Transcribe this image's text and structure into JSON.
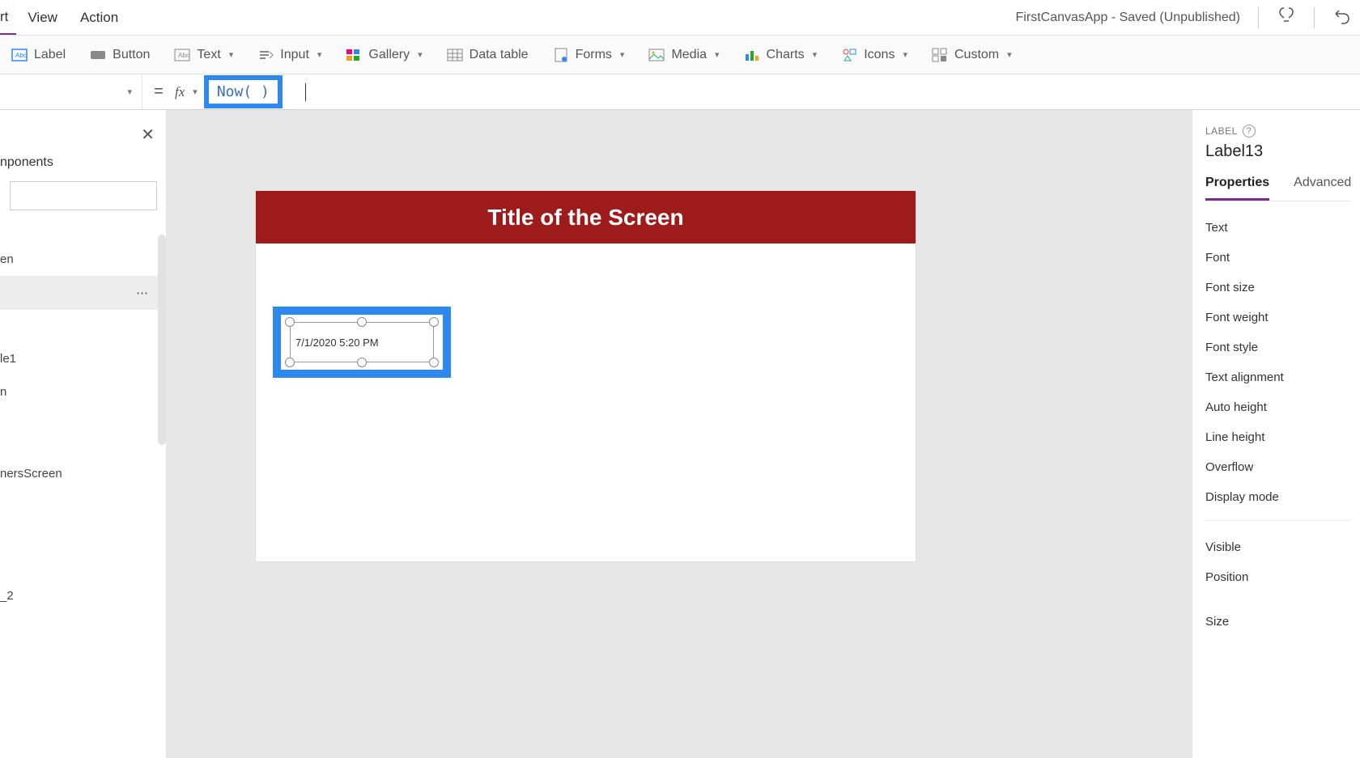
{
  "menubar": {
    "active_tab_fragment": "rt",
    "items": [
      "View",
      "Action"
    ],
    "app_status": "FirstCanvasApp - Saved (Unpublished)"
  },
  "ribbon": {
    "label": "Label",
    "button": "Button",
    "text": "Text",
    "input": "Input",
    "gallery": "Gallery",
    "datatable": "Data table",
    "forms": "Forms",
    "media": "Media",
    "charts": "Charts",
    "icons": "Icons",
    "custom": "Custom"
  },
  "formula": {
    "fx": "fx",
    "expr": "Now( )"
  },
  "tree": {
    "tab_fragment": "nponents",
    "items_fragments": [
      "en",
      "",
      "le1",
      "n",
      "nersScreen",
      "_2"
    ]
  },
  "canvas": {
    "screen_title": "Title of the Screen",
    "label_value": "7/1/2020 5:20 PM"
  },
  "rpanel": {
    "section": "LABEL",
    "control_name": "Label13",
    "tabs": {
      "properties": "Properties",
      "advanced": "Advanced"
    },
    "props": [
      "Text",
      "Font",
      "Font size",
      "Font weight",
      "Font style",
      "Text alignment",
      "Auto height",
      "Line height",
      "Overflow",
      "Display mode"
    ],
    "props_section2": [
      "Visible",
      "Position",
      "Size"
    ]
  }
}
